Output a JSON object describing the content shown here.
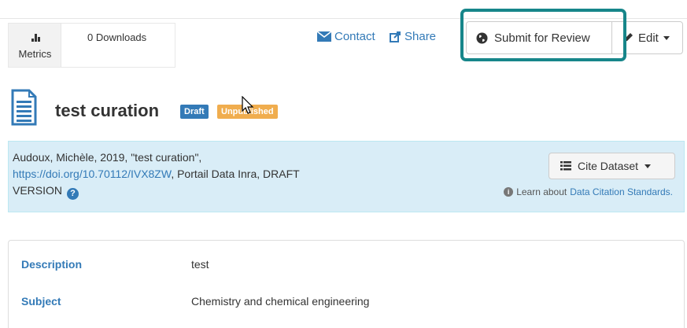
{
  "metrics": {
    "tab_label": "Metrics",
    "downloads": "0 Downloads"
  },
  "actions": {
    "contact_label": "Contact",
    "share_label": "Share",
    "submit_label": "Submit for Review",
    "edit_label": "Edit"
  },
  "dataset": {
    "title": "test curation",
    "badges": [
      "Draft",
      "Unpublished"
    ]
  },
  "citation": {
    "line1": "Audoux, Michèle, 2019, \"test curation\",",
    "doi_link": "https://doi.org/10.70112/IVX8ZW",
    "line2_rest": ", Portail Data Inra, DRAFT",
    "line3": "VERSION",
    "cite_button": "Cite Dataset",
    "learn_prefix": "Learn about",
    "learn_link": "Data Citation Standards."
  },
  "metadata": {
    "rows": [
      {
        "label": "Description",
        "value": "test"
      },
      {
        "label": "Subject",
        "value": "Chemistry and chemical engineering"
      }
    ]
  },
  "colors": {
    "link_blue": "#337ab7",
    "draft_badge": "#337ab7",
    "unpublished_badge": "#f0ad4e",
    "highlight_teal": "#17868a",
    "citation_panel_bg": "#d9edf7"
  }
}
